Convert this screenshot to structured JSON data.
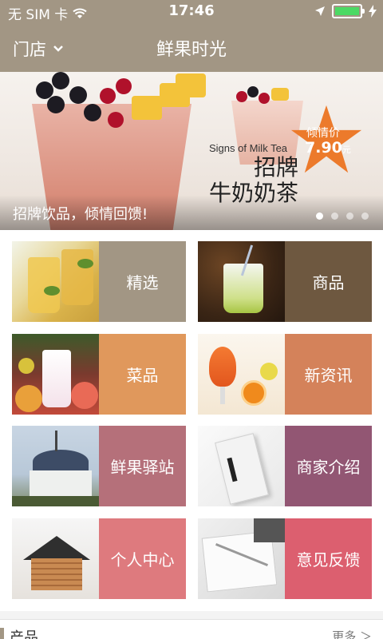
{
  "status_bar": {
    "carrier": "无 SIM 卡",
    "time": "17:46",
    "battery_level": 1.0
  },
  "nav": {
    "store_label": "门店",
    "title": "鲜果时光"
  },
  "banner": {
    "english_text": "Signs of Milk Tea",
    "headline_line1": "招牌",
    "headline_line2": "牛奶奶茶",
    "price_label": "倾情价",
    "price_value": "7.90",
    "price_unit": "元",
    "caption": "招牌饮品，倾情回馈!",
    "page_count": 4,
    "active_page": 1
  },
  "grid": {
    "tiles": [
      {
        "label": "精选",
        "color": "#a29684",
        "icon": "lime-drinks-photo"
      },
      {
        "label": "商品",
        "color": "#6e5840",
        "icon": "cocktail-photo"
      },
      {
        "label": "菜品",
        "color": "#e0985c",
        "icon": "smoothie-fruit-photo"
      },
      {
        "label": "新资讯",
        "color": "#d4825a",
        "icon": "orange-juice-photo"
      },
      {
        "label": "鲜果驿站",
        "color": "#b5707a",
        "icon": "building-photo"
      },
      {
        "label": "商家介绍",
        "color": "#925673",
        "icon": "book-photo"
      },
      {
        "label": "个人中心",
        "color": "#de7a7e",
        "icon": "coin-house-photo"
      },
      {
        "label": "意见反馈",
        "color": "#dc5f6f",
        "icon": "notebook-photo"
      }
    ]
  },
  "section": {
    "title": "产品",
    "more": "更多 ＞"
  }
}
